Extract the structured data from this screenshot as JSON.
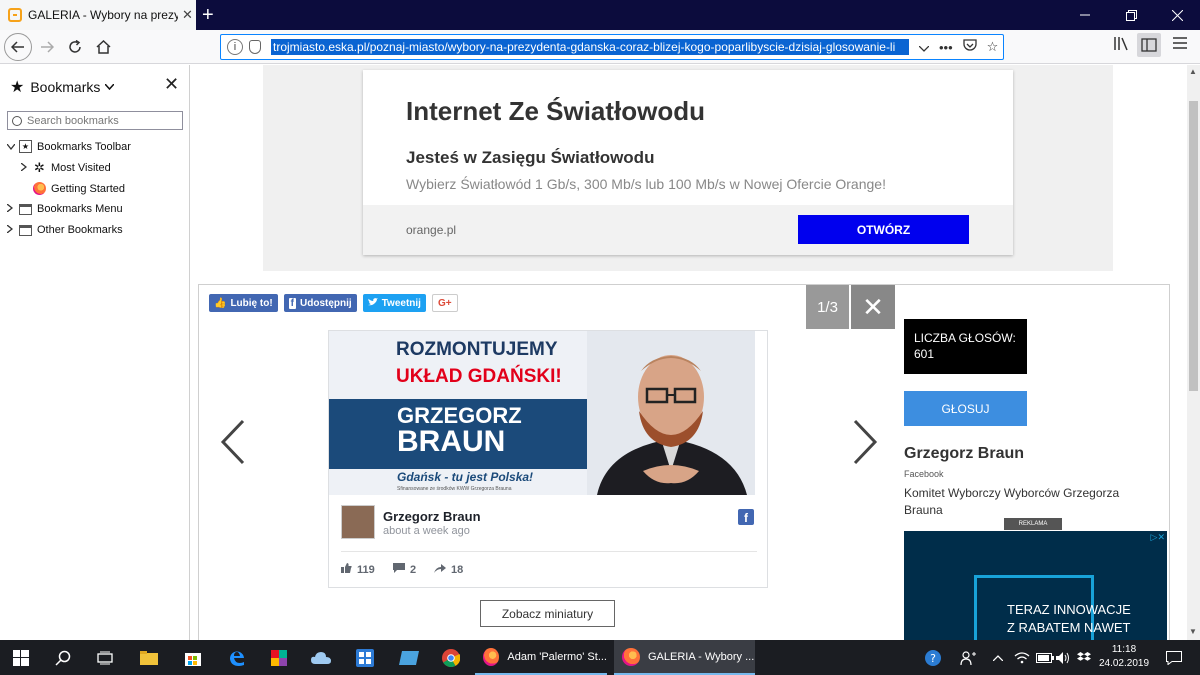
{
  "browser": {
    "tab_title": "GALERIA - Wybory na prezydenta",
    "tab_close": "✕",
    "new_tab": "+",
    "url": "trojmiasto.eska.pl/poznaj-miasto/wybory-na-prezydenta-gdanska-coraz-blizej-kogo-poparlibyscie-dzisiaj-glosowanie-li"
  },
  "sidebar": {
    "title": "Bookmarks",
    "search_placeholder": "Search bookmarks",
    "items": [
      {
        "label": "Bookmarks Toolbar",
        "icon": "bookmarks-toolbar-icon"
      },
      {
        "label": "Most Visited",
        "icon": "gear-icon"
      },
      {
        "label": "Getting Started",
        "icon": "firefox-icon"
      },
      {
        "label": "Bookmarks Menu",
        "icon": "folder-icon"
      },
      {
        "label": "Other Bookmarks",
        "icon": "folder-icon"
      }
    ]
  },
  "ad": {
    "title": "Internet Ze Światłowodu",
    "subtitle": "Jesteś w Zasięgu Światłowodu",
    "description": "Wybierz Światłowód 1 Gb/s, 300 Mb/s lub 100 Mb/s w Nowej Ofercie Orange!",
    "domain": "orange.pl",
    "button": "OTWÓRZ"
  },
  "gallery": {
    "share": {
      "like": "Lubię to!",
      "share": "Udostępnij",
      "tweet": "Tweetnij",
      "gplus": "G+"
    },
    "counter": "1/3",
    "close": "✕",
    "banner": {
      "line1": "ROZMONTUJEMY",
      "line2": "UKŁAD GDAŃSKI!",
      "name_first": "GRZEGORZ",
      "name_last": "BRAUN",
      "slogan": "Gdańsk - tu jest Polska!",
      "fine_print": "Sfinansowane ze środków KWW Grzegorza Brauna"
    },
    "post": {
      "author": "Grzegorz Braun",
      "time": "about a week ago",
      "fb_glyph": "f",
      "likes": "119",
      "comments": "2",
      "shares": "18"
    },
    "thumbnails_button": "Zobacz miniatury",
    "votes_label": "LICZBA GŁOSÓW: 601",
    "vote_button": "GŁOSUJ",
    "candidate": {
      "name": "Grzegorz Braun",
      "source": "Facebook",
      "description": "Komitet Wyborczy Wyborców Grzegorza Brauna"
    },
    "ad_label": "REKLAMA",
    "ad2": {
      "line1": "TERAZ INNOWACJE",
      "line2": "Z RABATEM NAWET",
      "adchoices": "▷✕"
    }
  },
  "taskbar": {
    "apps": [
      {
        "label": "Adam 'Palermo' St..."
      },
      {
        "label": "GALERIA - Wybory ..."
      }
    ],
    "time": "11:18",
    "date": "24.02.2019"
  },
  "colors": {
    "titlebar": "#0c0c3d",
    "url_highlight": "#0a64d2",
    "ad_button": "#0000ee",
    "vote_button": "#3d8ee0",
    "facebook": "#4267b2",
    "twitter": "#1da1f2"
  }
}
